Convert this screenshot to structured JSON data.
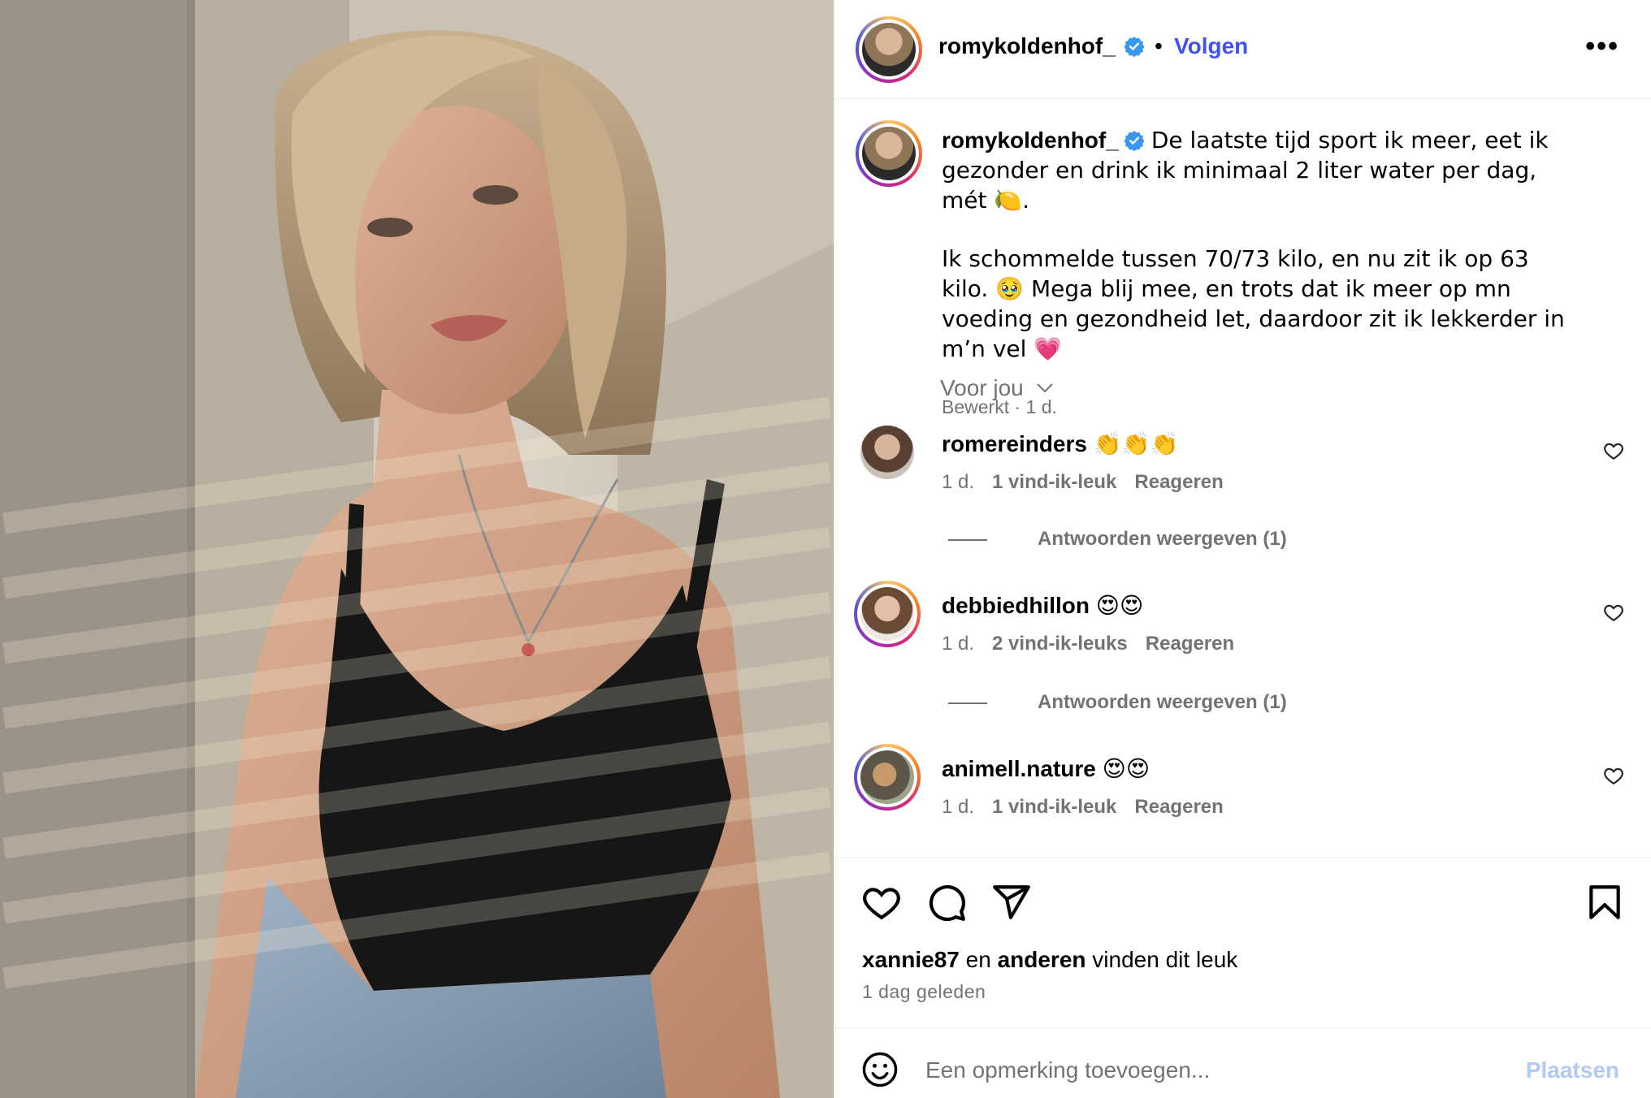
{
  "post": {
    "author": "romykoldenhof_",
    "follow_label": "Volgen",
    "separator": "•",
    "more_label": "•••",
    "caption_lines": [
      "De laatste tijd sport ik meer, eet ik gezonder en drink ik minimaal 2 liter water per dag, mét 🍋.",
      "Ik schommelde tussen 70/73 kilo, en nu zit ik op 63 kilo. 🥹 Mega blij mee, en trots dat ik meer op mn voeding en gezondheid let, daardoor zit ik lekkerder in m’n vel 💗"
    ],
    "caption_meta": "Bewerkt · 1 d.",
    "for_you_label": "Voor jou",
    "likes_user": "xannie87",
    "likes_and": "en",
    "likes_others": "anderen",
    "likes_suffix": "vinden dit leuk",
    "time_ago": "1 dag geleden",
    "comment_placeholder": "Een opmerking toevoegen...",
    "post_label": "Plaatsen"
  },
  "comments": [
    {
      "user": "romereinders",
      "text": "👏👏👏",
      "age": "1 d.",
      "likes": "1 vind-ik-leuk",
      "reply": "Reageren",
      "view_replies": "Antwoorden weergeven (1)"
    },
    {
      "user": "debbiedhillon",
      "text": "😍😍",
      "age": "1 d.",
      "likes": "2 vind-ik-leuks",
      "reply": "Reageren",
      "view_replies": "Antwoorden weergeven (1)"
    },
    {
      "user": "animell.nature",
      "text": "😍😍",
      "age": "1 d.",
      "likes": "1 vind-ik-leuk",
      "reply": "Reageren"
    }
  ],
  "colors": {
    "accent": "#4150f7",
    "verified": "#3897f0",
    "muted": "#737373",
    "post_disabled": "#b2c9f7"
  },
  "icons": [
    "verified-badge-icon",
    "chevron-down-icon",
    "heart-icon",
    "comment-icon",
    "share-icon",
    "bookmark-icon",
    "emoji-icon"
  ]
}
